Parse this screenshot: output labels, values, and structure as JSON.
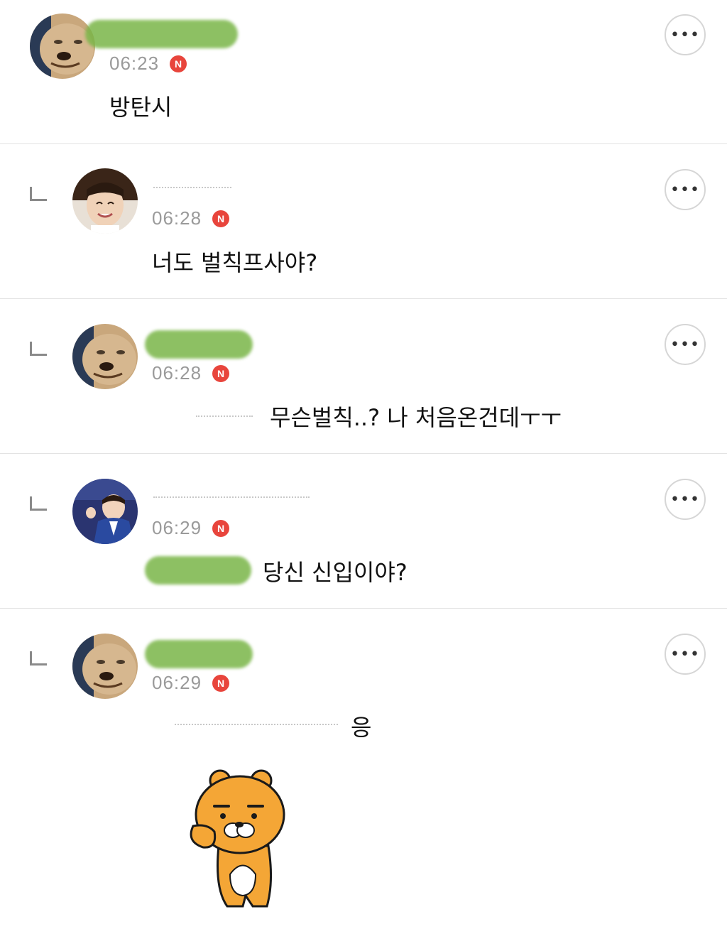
{
  "comments": [
    {
      "time": "06:23",
      "badge": "N",
      "text": "방탄시",
      "more": "•••"
    },
    {
      "time": "06:28",
      "badge": "N",
      "text": "너도 벌칙프사야?",
      "more": "•••"
    },
    {
      "time": "06:28",
      "badge": "N",
      "text": "무슨벌칙..? 나 처음온건데ㅜㅜ",
      "more": "•••"
    },
    {
      "time": "06:29",
      "badge": "N",
      "text": "당신 신입이야?",
      "more": "•••"
    },
    {
      "time": "06:29",
      "badge": "N",
      "text": "응",
      "more": "•••"
    }
  ],
  "icons": {
    "reply": "reply-arrow-icon",
    "more": "more-options-icon",
    "new": "new-badge-icon",
    "sticker": "ryan-bear-sticker"
  },
  "colors": {
    "new_badge": "#e8453c",
    "censor_smudge": "#7ab648",
    "divider": "#e3e3e3",
    "time_text": "#9a9a9a"
  }
}
